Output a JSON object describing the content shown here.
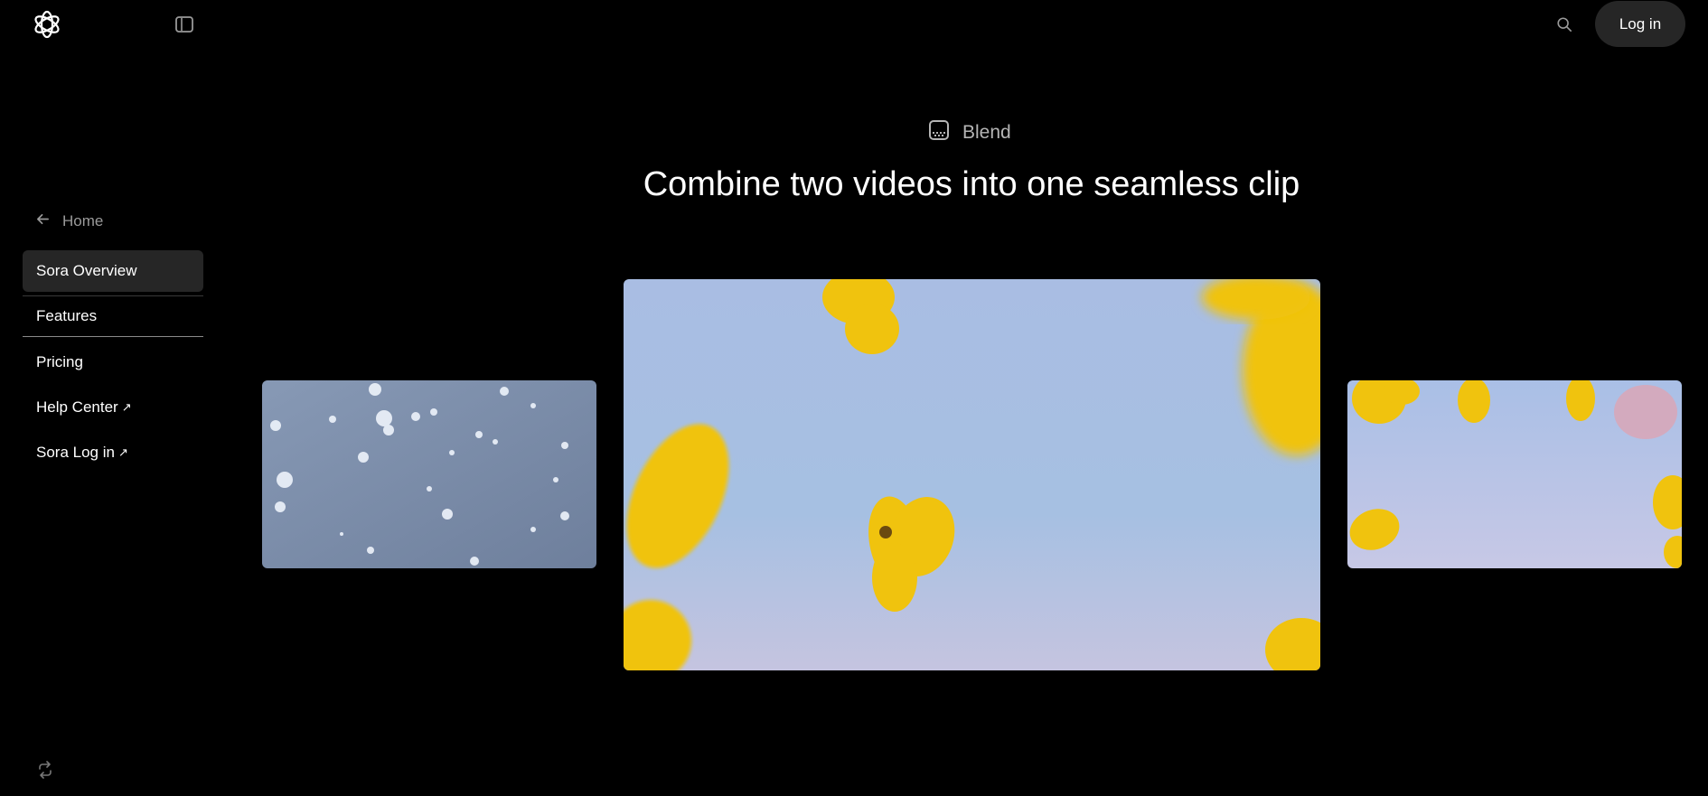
{
  "header": {
    "logo_icon": "openai-logo-icon",
    "sidebar_toggle_icon": "sidebar-toggle-icon",
    "search_icon": "search-icon",
    "login_label": "Log in"
  },
  "sidebar": {
    "home_label": "Home",
    "items": [
      {
        "label": "Sora Overview",
        "active": true
      },
      {
        "label": "Features",
        "active": false
      },
      {
        "label": "Pricing",
        "active": false
      },
      {
        "label": "Help Center",
        "external": true
      },
      {
        "label": "Sora Log in",
        "external": true
      }
    ],
    "external_glyph": "↗",
    "footer_icon": "refresh-icon"
  },
  "main": {
    "badge_label": "Blend",
    "badge_icon": "blend-icon",
    "headline": "Combine two videos into one seamless clip"
  },
  "media": {
    "left_video": "snowflakes-video",
    "center_video": "yellow-petals-blend-video",
    "right_video": "yellow-flowers-video"
  },
  "colors": {
    "background": "#000000",
    "button_bg": "#262626",
    "sky": "#a8bde0",
    "petal": "#f2c511",
    "snow_sky": "#7e8fab"
  }
}
